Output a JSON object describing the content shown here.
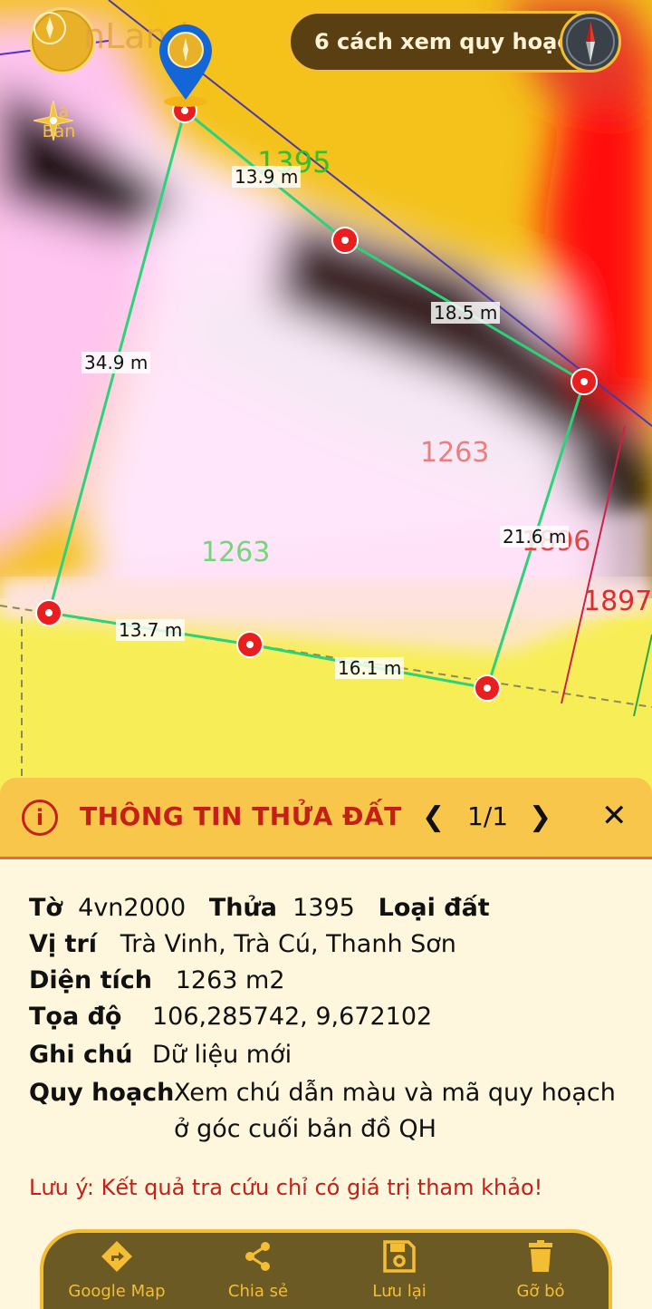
{
  "map": {
    "logo_text": "nLand",
    "compass_label": "La Bàn",
    "planning_button": "6 cách xem quy hoạch",
    "parcel_numbers": [
      {
        "text": "1395",
        "color": "#30c030"
      },
      {
        "text": "1263",
        "color": "#e88080"
      },
      {
        "text": "1263",
        "color": "#7ad27a"
      },
      {
        "text": "1896",
        "color": "#e04848"
      },
      {
        "text": "1897",
        "color": "#d83030"
      }
    ],
    "edge_lengths": [
      "13.9 m",
      "18.5 m",
      "34.9 m",
      "21.6 m",
      "13.7 m",
      "16.1 m"
    ]
  },
  "panel": {
    "title": "THÔNG TIN THỬA ĐẤT",
    "page_indicator": "1/1",
    "prev_icon": "chevron-left-icon",
    "next_icon": "chevron-right-icon",
    "close_icon": "close-icon",
    "sheet_label": "Tờ",
    "sheet_value": "4vn2000",
    "plot_label": "Thửa",
    "plot_value": "1395",
    "landtype_label": "Loại đất",
    "location_label": "Vị trí",
    "location_value": "Trà Vinh, Trà Cú, Thanh Sơn",
    "area_label": "Diện tích",
    "area_value": "1263 m2",
    "coord_label": "Tọa độ",
    "coord_value": "106,285742, 9,672102",
    "note_label": "Ghi chú",
    "note_value": "Dữ liệu mới",
    "planning_label": "Quy hoạch",
    "planning_value_1": "Xem chú dẫn màu và mã quy hoạch",
    "planning_value_2": "ở góc cuối bản đồ QH",
    "disclaimer": "Lưu ý: Kết quả tra cứu chỉ có giá trị tham khảo!"
  },
  "toolbar": {
    "items": [
      {
        "label": "Google Map",
        "icon": "directions-icon"
      },
      {
        "label": "Chia sẻ",
        "icon": "share-icon"
      },
      {
        "label": "Lưu lại",
        "icon": "save-icon"
      },
      {
        "label": "Gỡ bỏ",
        "icon": "trash-icon"
      }
    ]
  },
  "colors": {
    "accent": "#f3be34",
    "header_bg": "#f8c64a",
    "alert_red": "#c42018",
    "toolbar_bg": "#6b5a24"
  }
}
